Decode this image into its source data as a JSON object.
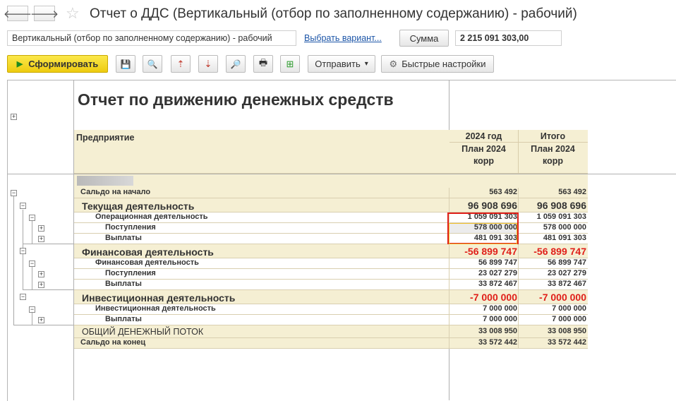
{
  "window": {
    "title": "Отчет о ДДС (Вертикальный (отбор по заполненному содержанию) - рабочий)",
    "back_glyph": "🡐",
    "forward_glyph": "🡒",
    "star_glyph": "☆"
  },
  "settings_bar": {
    "variant_value": "Вертикальный (отбор по заполненному содержанию) - рабочий",
    "choose_variant_link": "Выбрать вариант...",
    "sum_button": "Сумма",
    "sum_value": "2 215 091 303,00"
  },
  "toolbar": {
    "generate_label": "Сформировать",
    "generate_icon": "▶",
    "send_label": "Отправить",
    "send_arrow": "▾",
    "quick_settings_label": "Быстрые настройки",
    "tools": [
      {
        "name": "save-icon",
        "glyph": "💾"
      },
      {
        "name": "search-icon",
        "glyph": "🔍"
      },
      {
        "name": "sort-asc-icon",
        "glyph": "⇡"
      },
      {
        "name": "sort-desc-icon",
        "glyph": "⇣"
      },
      {
        "name": "preview-icon",
        "glyph": "🔎"
      },
      {
        "name": "print-icon",
        "glyph": "🖶"
      },
      {
        "name": "add-icon",
        "glyph": "⊞"
      }
    ],
    "quick_settings_icon": "⚙"
  },
  "report": {
    "title": "Отчет по движению денежных средств",
    "header": {
      "row_label": "Предприятие",
      "col1_group": "2024 год",
      "col1_sub": "План 2024 корр",
      "col2_group": "Итого",
      "col2_sub": "План 2024 корр"
    },
    "expand_glyph": "+",
    "collapse_glyph": "−",
    "rows": [
      {
        "label": "Сальдо на начало",
        "v1": "563 492",
        "v2": "563 492"
      },
      {
        "label": "Текущая деятельность",
        "v1": "96 908 696",
        "v2": "96 908 696"
      },
      {
        "label": "Операционная деятельность",
        "v1": "1 059 091 303",
        "v2": "1 059 091 303"
      },
      {
        "label": "Поступления",
        "v1": "578 000 000",
        "v2": "578 000 000"
      },
      {
        "label": "Выплаты",
        "v1": "481 091 303",
        "v2": "481 091 303"
      },
      {
        "label": "Финансовая деятельность",
        "v1": "-56 899 747",
        "v2": "-56 899 747"
      },
      {
        "label": "Финансовая деятельность",
        "v1": "56 899 747",
        "v2": "56 899 747"
      },
      {
        "label": "Поступления",
        "v1": "23 027 279",
        "v2": "23 027 279"
      },
      {
        "label": "Выплаты",
        "v1": "33 872 467",
        "v2": "33 872 467"
      },
      {
        "label": "Инвестиционная деятельность",
        "v1": "-7 000 000",
        "v2": "-7 000 000"
      },
      {
        "label": "Инвестиционная деятельность",
        "v1": "7 000 000",
        "v2": "7 000 000"
      },
      {
        "label": "Выплаты",
        "v1": "7 000 000",
        "v2": "7 000 000"
      },
      {
        "label": "ОБЩИЙ ДЕНЕЖНЫЙ ПОТОК",
        "v1": "33 008 950",
        "v2": "33 008 950"
      },
      {
        "label": "Сальдо на конец",
        "v1": "33 572 442",
        "v2": "33 572 442"
      }
    ]
  },
  "colors": {
    "band": "#f5efd3",
    "negative": "#e0201a",
    "selection": "#e0201a",
    "primary_button": "#f2d21c"
  }
}
